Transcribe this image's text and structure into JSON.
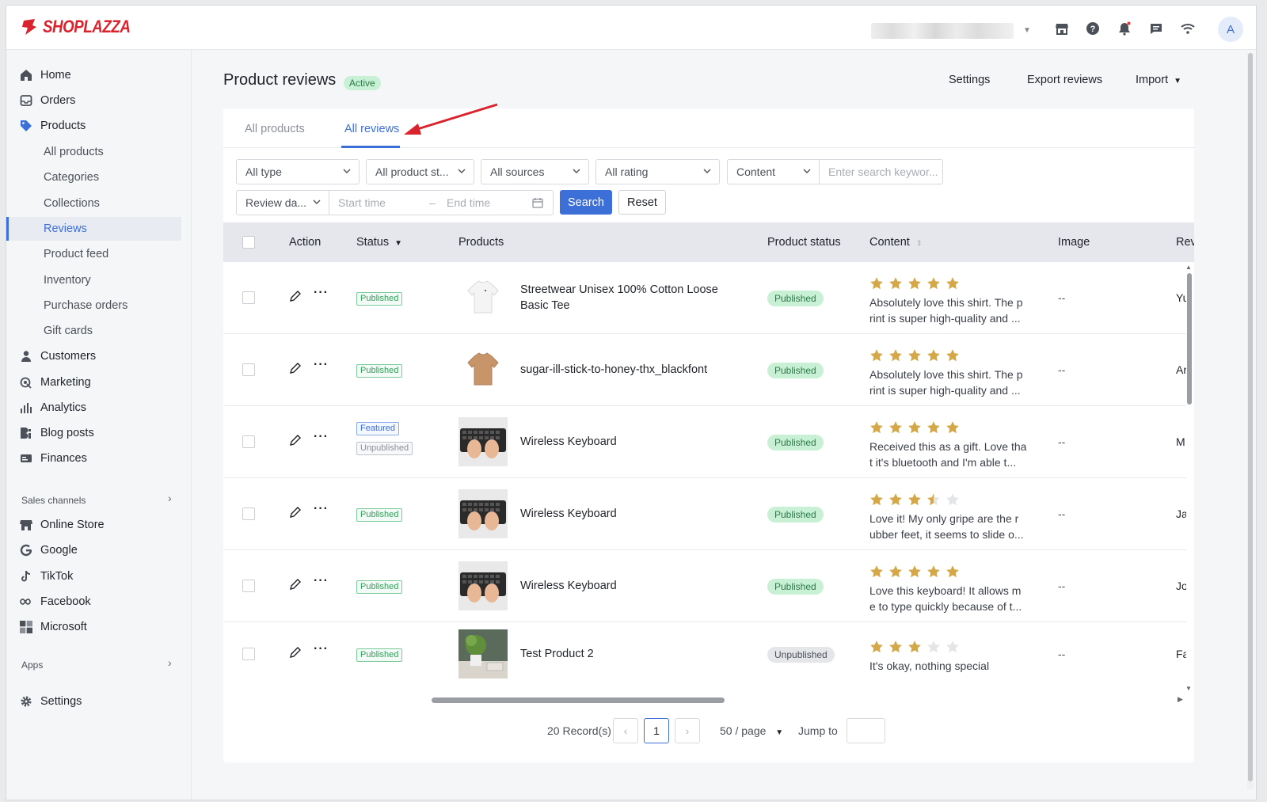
{
  "brand": {
    "name": "SHOPLAZZA",
    "color": "#d9232d"
  },
  "topbar": {
    "avatar_letter": "A",
    "icons": [
      "store-icon",
      "help-icon",
      "bell-icon",
      "chat-icon",
      "wifi-icon"
    ]
  },
  "sidebar": {
    "items": [
      {
        "label": "Home",
        "icon": "home-icon"
      },
      {
        "label": "Orders",
        "icon": "orders-icon"
      },
      {
        "label": "Products",
        "icon": "tag-icon"
      },
      {
        "label": "All products"
      },
      {
        "label": "Categories"
      },
      {
        "label": "Collections"
      },
      {
        "label": "Reviews"
      },
      {
        "label": "Product feed"
      },
      {
        "label": "Inventory"
      },
      {
        "label": "Purchase orders"
      },
      {
        "label": "Gift cards"
      },
      {
        "label": "Customers",
        "icon": "person-icon"
      },
      {
        "label": "Marketing",
        "icon": "marketing-icon"
      },
      {
        "label": "Analytics",
        "icon": "analytics-icon"
      },
      {
        "label": "Blog posts",
        "icon": "blog-icon"
      },
      {
        "label": "Finances",
        "icon": "finances-icon"
      }
    ],
    "sales_channels_label": "Sales channels",
    "channels": [
      {
        "label": "Online Store",
        "icon": "online-store-icon"
      },
      {
        "label": "Google",
        "icon": "google-icon"
      },
      {
        "label": "TikTok",
        "icon": "tiktok-icon"
      },
      {
        "label": "Facebook",
        "icon": "facebook-icon"
      },
      {
        "label": "Microsoft",
        "icon": "microsoft-icon"
      }
    ],
    "apps_label": "Apps",
    "settings_label": "Settings"
  },
  "page": {
    "title": "Product reviews",
    "status_badge": "Active",
    "actions": {
      "settings": "Settings",
      "export": "Export reviews",
      "import": "Import"
    }
  },
  "tabs": [
    "All products",
    "All reviews"
  ],
  "filters": {
    "type": "All type",
    "product_status": "All product st...",
    "sources": "All sources",
    "rating": "All rating",
    "content_field": "Content",
    "search_placeholder": "Enter search keywor...",
    "date_field": "Review da...",
    "start_time": "Start time",
    "end_time": "End time",
    "search_button": "Search",
    "reset_button": "Reset"
  },
  "table": {
    "headers": {
      "action": "Action",
      "status": "Status",
      "products": "Products",
      "product_status": "Product status",
      "content": "Content",
      "image": "Image",
      "reviewer": "Rev"
    },
    "rows": [
      {
        "status_tags": [
          "Published"
        ],
        "product": "Streetwear Unisex 100% Cotton Loose Basic Tee",
        "thumb": "white-tee",
        "product_status": "Published",
        "rating": 5,
        "review": "Absolutely love this shirt. The p rint is super high-quality and ...",
        "image": "--",
        "reviewer": "Yu"
      },
      {
        "status_tags": [
          "Published"
        ],
        "product": "sugar-ill-stick-to-honey-thx_blackfont",
        "thumb": "tan-tee",
        "product_status": "Published",
        "rating": 5,
        "review": "Absolutely love this shirt. The p rint is super high-quality and ...",
        "image": "--",
        "reviewer": "Ar"
      },
      {
        "status_tags": [
          "Featured",
          "Unpublished"
        ],
        "product": "Wireless Keyboard",
        "thumb": "keyboard",
        "product_status": "Published",
        "rating": 5,
        "review": "Received this as a gift. Love tha t it's bluetooth and I'm able t...",
        "image": "--",
        "reviewer": "M"
      },
      {
        "status_tags": [
          "Published"
        ],
        "product": "Wireless Keyboard",
        "thumb": "keyboard",
        "product_status": "Published",
        "rating": 3.5,
        "review": "Love it! My only gripe are the r ubber feet, it seems to slide o...",
        "image": "--",
        "reviewer": "Ja"
      },
      {
        "status_tags": [
          "Published"
        ],
        "product": "Wireless Keyboard",
        "thumb": "keyboard",
        "product_status": "Published",
        "rating": 5,
        "review": "Love this keyboard! It allows m e to type quickly because of t...",
        "image": "--",
        "reviewer": "Jo"
      },
      {
        "status_tags": [
          "Published"
        ],
        "product": "Test Product 2",
        "thumb": "plant",
        "product_status": "Unpublished",
        "rating": 3,
        "review": "It's okay, nothing special",
        "image": "--",
        "reviewer": "Fa"
      }
    ]
  },
  "pagination": {
    "records": "20 Record(s)",
    "current_page": "1",
    "page_size": "50 / page",
    "jump_label": "Jump to"
  },
  "colors": {
    "accent": "#3d6fd8",
    "star": "#d4a849",
    "published_bg": "#c8f0d5",
    "annotation_arrow": "#d9232d"
  }
}
